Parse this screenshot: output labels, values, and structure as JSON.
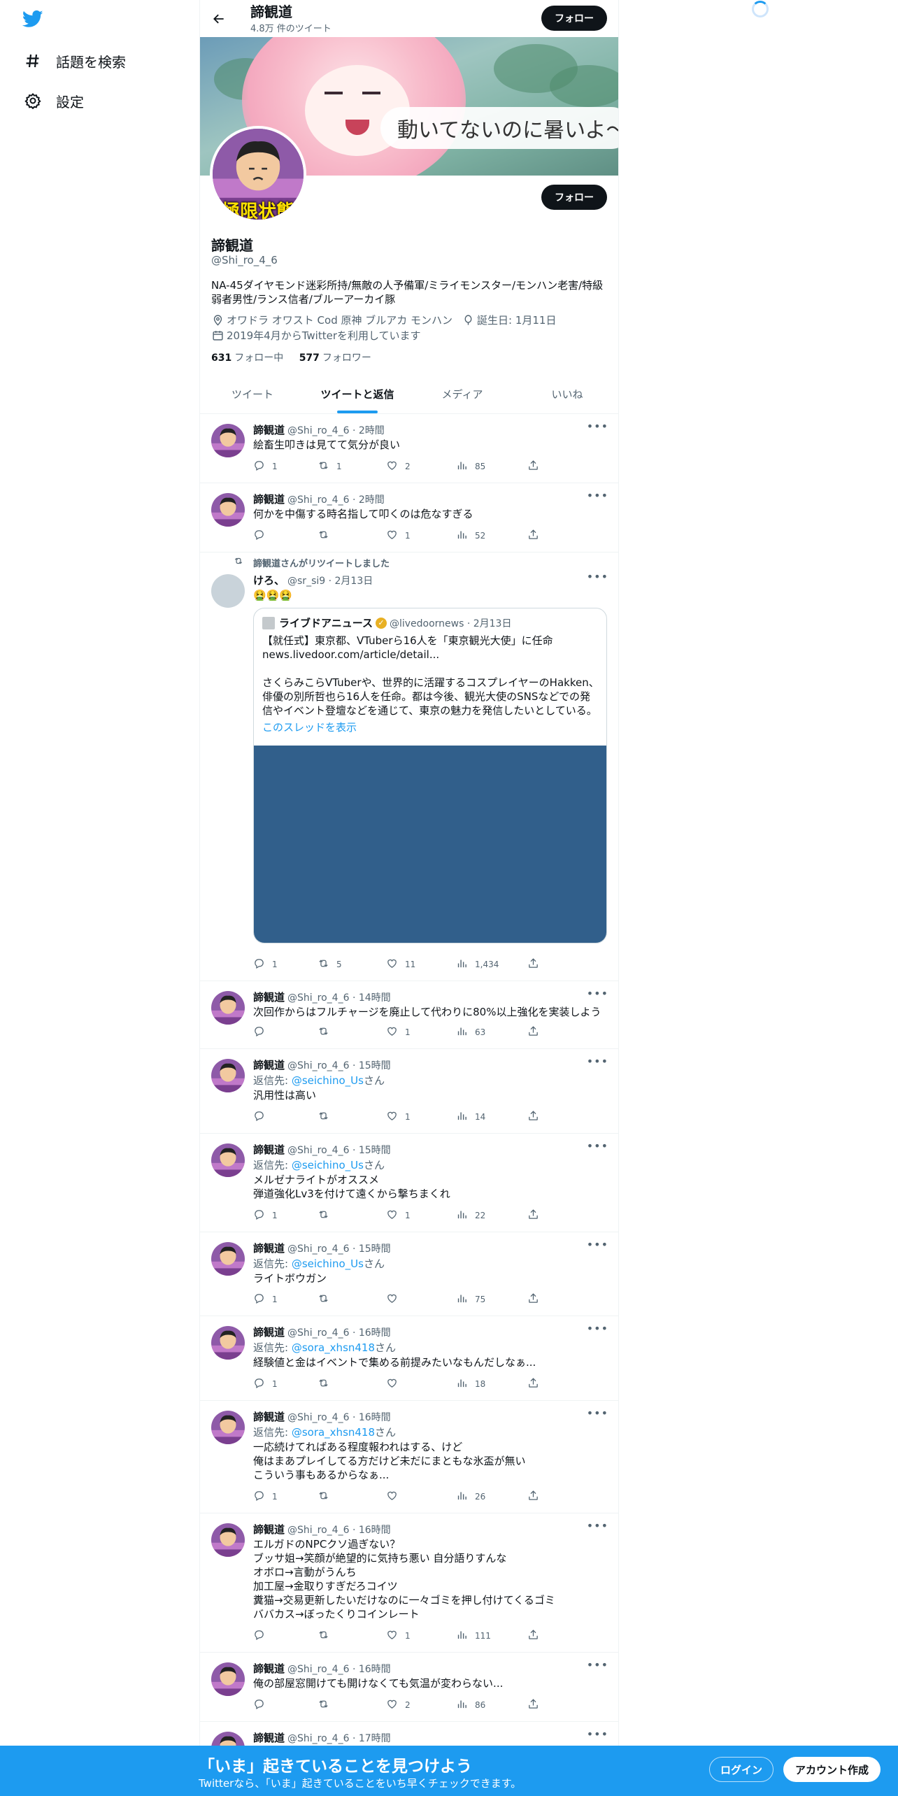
{
  "sidebar": {
    "items": [
      {
        "label": "話題を検索",
        "icon": "hashtag-icon"
      },
      {
        "label": "設定",
        "icon": "gear-icon"
      }
    ]
  },
  "topbar": {
    "name": "諦観道",
    "tweet_count": "4.8万 件のツイート",
    "follow_label": "フォロー"
  },
  "banner": {
    "caption": "動いてないのに暑いよ〜…",
    "avatar_text": "極限状態"
  },
  "profile": {
    "name": "諦観道",
    "handle": "@Shi_ro_4_6",
    "follow_label": "フォロー",
    "bio": "NA-45ダイヤモンド迷彩所持/無敵の人予備軍/ミライモンスター/モンハン老害/特級弱者男性/ランス信者/ブルーアーカイ豚",
    "location": "オワドラ オワスト Cod 原神 ブルアカ モンハン",
    "birthday": "誕生日: 1月11日",
    "joined": "2019年4月からTwitterを利用しています",
    "following_count": "631",
    "following_label": "フォロー中",
    "followers_count": "577",
    "followers_label": "フォロワー"
  },
  "tabs": [
    {
      "label": "ツイート",
      "active": false
    },
    {
      "label": "ツイートと返信",
      "active": true
    },
    {
      "label": "メディア",
      "active": false
    },
    {
      "label": "いいね",
      "active": false
    }
  ],
  "tweets": [
    {
      "name": "諦観道",
      "handle": "@Shi_ro_4_6 · 2時間",
      "text": "絵畜生叩きは見てて気分が良い",
      "reply": "1",
      "retweet": "1",
      "like": "2",
      "views": "85"
    },
    {
      "name": "諦観道",
      "handle": "@Shi_ro_4_6 · 2時間",
      "text": "何かを中傷する時名指して叩くのは危なすぎる",
      "reply": "",
      "retweet": "",
      "like": "1",
      "views": "52"
    },
    {
      "retweeted_by": "諦観道さんがリツイートしました",
      "name": "けろ、",
      "handle": "@sr_si9 · 2月13日",
      "text": "🤮🤮🤮",
      "quote": {
        "name": "ライブドアニュース",
        "handle": "@livedoornews · 2月13日",
        "text": "【就任式】東京都、VTuberら16人を「東京観光大使」に任命\nnews.livedoor.com/article/detail...\n\nさくらみこらVTuberや、世界的に活躍するコスプレイヤーのHakken、俳優の別所哲也ら16人を任命。都は今後、観光大使のSNSなどでの発信やイベント登壇などを通じて、東京の魅力を発信したいとしている。",
        "thread": "このスレッドを表示"
      },
      "reply": "1",
      "retweet": "5",
      "like": "11",
      "views": "1,434"
    },
    {
      "name": "諦観道",
      "handle": "@Shi_ro_4_6 · 14時間",
      "text": "次回作からはフルチャージを廃止して代わりに80%以上強化を実装しよう",
      "reply": "",
      "retweet": "",
      "like": "1",
      "views": "63"
    },
    {
      "name": "諦観道",
      "handle": "@Shi_ro_4_6 · 15時間",
      "reply_prefix": "返信先: ",
      "reply_to": "@seichino_Us",
      "reply_suffix": "さん",
      "text": "汎用性は高い",
      "reply": "",
      "retweet": "",
      "like": "1",
      "views": "14"
    },
    {
      "name": "諦観道",
      "handle": "@Shi_ro_4_6 · 15時間",
      "reply_prefix": "返信先: ",
      "reply_to": "@seichino_Us",
      "reply_suffix": "さん",
      "text": "メルゼナライトがオススメ\n弾道強化Lv3を付けて遠くから撃ちまくれ",
      "reply": "1",
      "retweet": "",
      "like": "1",
      "views": "22"
    },
    {
      "name": "諦観道",
      "handle": "@Shi_ro_4_6 · 15時間",
      "reply_prefix": "返信先: ",
      "reply_to": "@seichino_Us",
      "reply_suffix": "さん",
      "text": "ライトボウガン",
      "reply": "1",
      "retweet": "",
      "like": "",
      "views": "75"
    },
    {
      "name": "諦観道",
      "handle": "@Shi_ro_4_6 · 16時間",
      "reply_prefix": "返信先: ",
      "reply_to": "@sora_xhsn418",
      "reply_suffix": "さん",
      "text": "経験値と金はイベントで集める前提みたいなもんだしなぁ...",
      "reply": "1",
      "retweet": "",
      "like": "",
      "views": "18"
    },
    {
      "name": "諦観道",
      "handle": "@Shi_ro_4_6 · 16時間",
      "reply_prefix": "返信先: ",
      "reply_to": "@sora_xhsn418",
      "reply_suffix": "さん",
      "text": "一応続けてればある程度報われはする、けど\n俺はまあプレイしてる方だけど未だにまともな氷盃が無い\nこういう事もあるからなぁ...",
      "reply": "1",
      "retweet": "",
      "like": "",
      "views": "26"
    },
    {
      "name": "諦観道",
      "handle": "@Shi_ro_4_6 · 16時間",
      "text": "エルガドのNPCクソ過ぎない？\nブッサ姐→笑顔が絶望的に気持ち悪い 自分語りすんな\nオボロ→言動がうんち\n加工屋→金取りすぎだろコイツ\n糞猫→交易更新したいだけなのに一々ゴミを押し付けてくるゴミ\nババカス→ぼったくりコインレート",
      "reply": "",
      "retweet": "",
      "like": "1",
      "views": "111"
    },
    {
      "name": "諦観道",
      "handle": "@Shi_ro_4_6 · 16時間",
      "text": "俺の部屋窓開けても開けなくても気温が変わらない...",
      "reply": "",
      "retweet": "",
      "like": "2",
      "views": "86"
    },
    {
      "name": "諦観道",
      "handle": "@Shi_ro_4_6 · 17時間",
      "text": ""
    }
  ],
  "bottombar": {
    "title": "「いま」起きていることを見つけよう",
    "subtitle": "Twitterなら、「いま」起きていることをいち早くチェックできます。",
    "login_label": "ログイン",
    "signup_label": "アカウント作成"
  },
  "colors": {
    "accent": "#1d9bf0",
    "text": "#0f1419",
    "muted": "#536471"
  }
}
